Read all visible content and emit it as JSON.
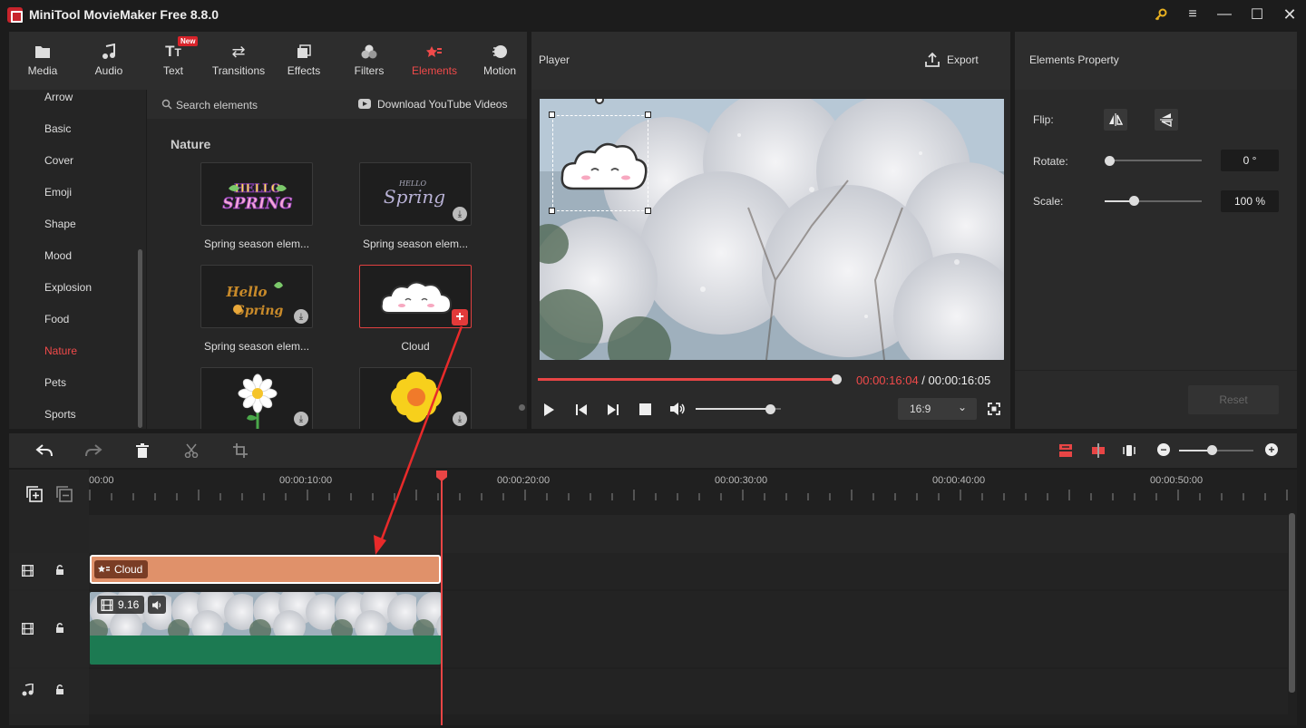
{
  "app": {
    "title": "MiniTool MovieMaker Free 8.8.0"
  },
  "toolbar": {
    "tabs": [
      {
        "label": "Media",
        "icon": "folder-icon"
      },
      {
        "label": "Audio",
        "icon": "music-note-icon"
      },
      {
        "label": "Text",
        "icon": "text-icon",
        "badge": "New"
      },
      {
        "label": "Transitions",
        "icon": "transitions-icon"
      },
      {
        "label": "Effects",
        "icon": "effects-icon"
      },
      {
        "label": "Filters",
        "icon": "filters-icon"
      },
      {
        "label": "Elements",
        "icon": "elements-icon",
        "active": true
      },
      {
        "label": "Motion",
        "icon": "motion-icon"
      }
    ]
  },
  "sidebar": {
    "items": [
      "Arrow",
      "Basic",
      "Cover",
      "Emoji",
      "Shape",
      "Mood",
      "Explosion",
      "Food",
      "Nature",
      "Pets",
      "Sports"
    ],
    "active": "Nature"
  },
  "content": {
    "search_placeholder": "Search elements",
    "download_link": "Download YouTube Videos",
    "section_title": "Nature",
    "elements": [
      {
        "label": "Spring season elem..."
      },
      {
        "label": "Spring season elem..."
      },
      {
        "label": "Spring season elem..."
      },
      {
        "label": "Cloud"
      }
    ]
  },
  "player": {
    "title": "Player",
    "export_label": "Export",
    "current_time": "00:00:16:04",
    "separator": " / ",
    "total_time": "00:00:16:05",
    "aspect": "16:9",
    "progress": 1.0,
    "volume": 0.88
  },
  "properties": {
    "title": "Elements Property",
    "flip_label": "Flip:",
    "rotate_label": "Rotate:",
    "rotate_value": "0 °",
    "scale_label": "Scale:",
    "scale_value": "100 %",
    "reset_label": "Reset",
    "rotate_level": 0.0,
    "scale_level": 0.3
  },
  "timeline": {
    "ruler_labels": [
      "00:00",
      "00:00:10:00",
      "00:00:20:00",
      "00:00:30:00",
      "00:00:40:00",
      "00:00:50:00"
    ],
    "element_clip_label": "Cloud",
    "video_clip_duration": "9.16",
    "zoom_level": 0.45
  },
  "colors": {
    "accent": "#f04a4a",
    "element_clip": "#e0916a",
    "video_audio_bar": "#1c7a52"
  }
}
